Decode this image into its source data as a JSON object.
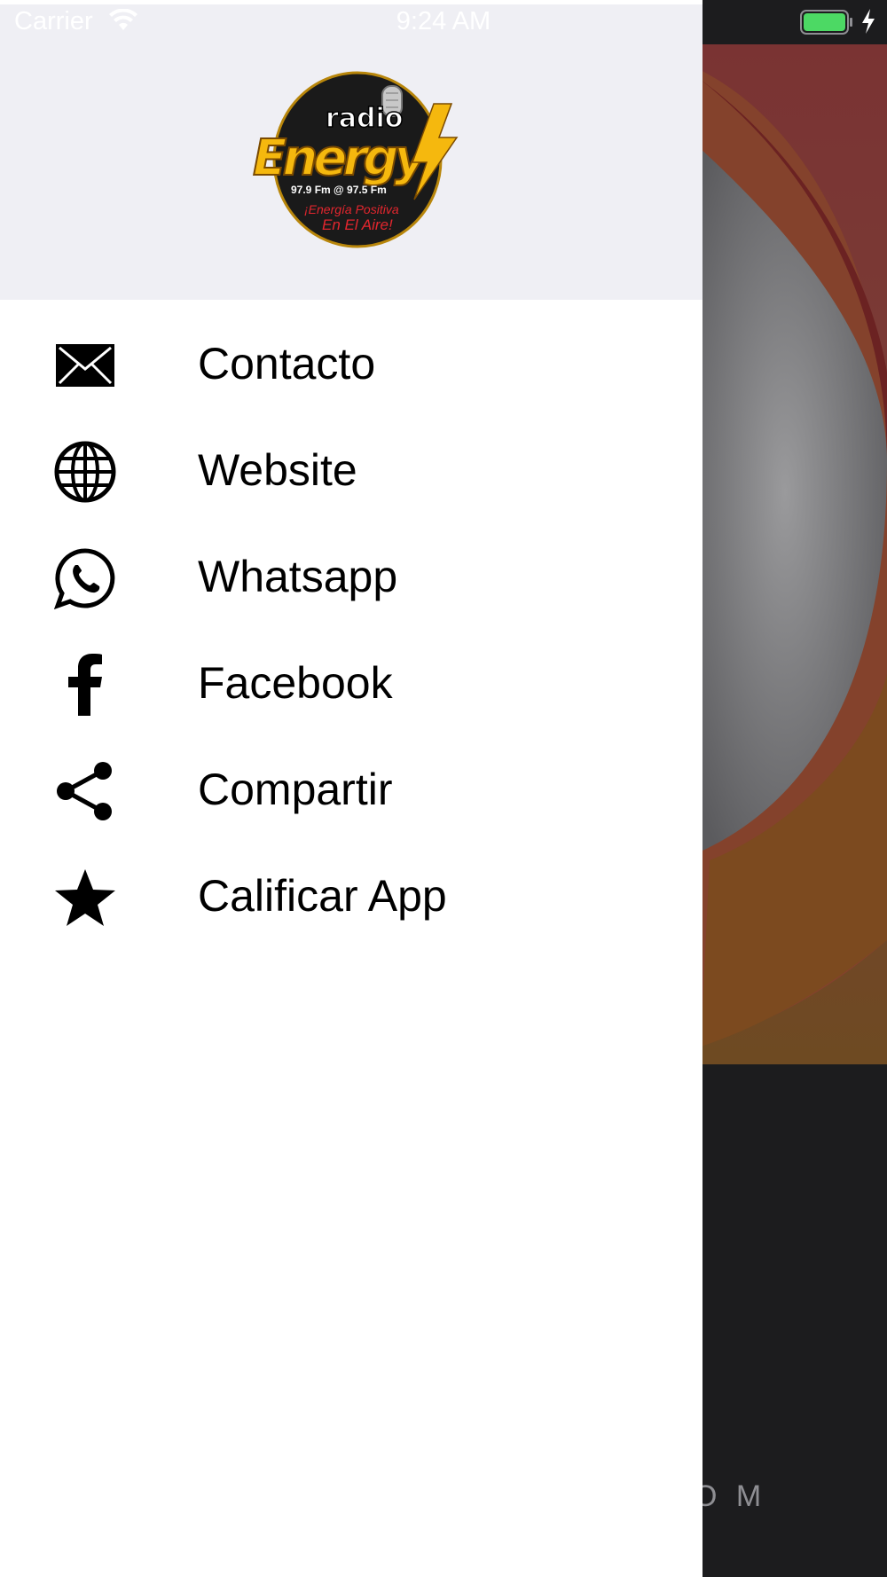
{
  "status_bar": {
    "carrier": "Carrier",
    "time": "9:24 AM",
    "battery_color": "#4cd964"
  },
  "logo": {
    "brand_top": "radio",
    "brand_main": "Energy",
    "frequencies": "97.9 Fm @ 97.5 Fm",
    "slogan_1": "¡Energía Positiva",
    "slogan_2": "En El Aire!"
  },
  "menu": {
    "items": [
      {
        "label": "Contacto",
        "icon": "envelope-icon"
      },
      {
        "label": "Website",
        "icon": "globe-icon"
      },
      {
        "label": "Whatsapp",
        "icon": "whatsapp-icon"
      },
      {
        "label": "Facebook",
        "icon": "facebook-icon"
      },
      {
        "label": "Compartir",
        "icon": "share-icon"
      },
      {
        "label": "Calificar App",
        "icon": "star-icon"
      }
    ]
  },
  "background": {
    "domain_fragment": "O M"
  },
  "colors": {
    "header_bg": "#efeff4",
    "drawer_bg": "#ffffff",
    "accent_red": "#7a2a2a",
    "accent_orange": "#8a5020"
  }
}
